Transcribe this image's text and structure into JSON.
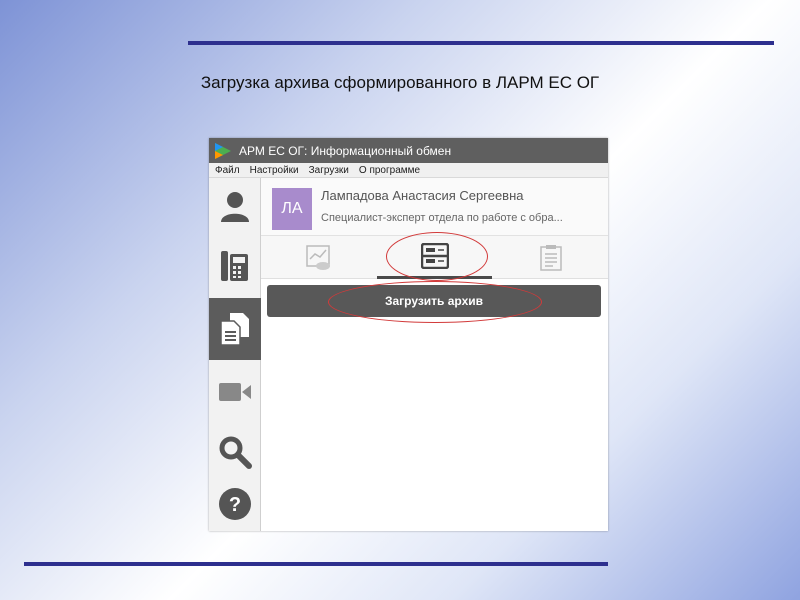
{
  "slide": {
    "title": "Загрузка архива сформированного в ЛАРМ ЕС ОГ"
  },
  "app": {
    "window_title": "АРМ ЕС ОГ: Информационный обмен",
    "menu": [
      "Файл",
      "Настройки",
      "Загрузки",
      "О программе"
    ],
    "user": {
      "initials": "ЛА",
      "name": "Лампадова Анастасия Сергеевна",
      "role": "Специалист-эксперт отдела по работе с обра..."
    },
    "sidebar_icons": [
      "user-icon",
      "phone-icon",
      "documents-icon",
      "video-icon",
      "search-icon",
      "help-icon"
    ],
    "active_sidebar": "documents-icon",
    "tabs": [
      {
        "icon": "cloud-chart-icon",
        "active": false
      },
      {
        "icon": "archive-icon",
        "active": true
      },
      {
        "icon": "document-list-icon",
        "active": false
      }
    ],
    "upload_button_label": "Загрузить архив",
    "colors": {
      "titlebar": "#5f5f5f",
      "active_sidebar": "#5c5c5c",
      "avatar": "#a88bcc",
      "button": "#585858",
      "highlight": "#d23a3a",
      "rule": "#2d2f8e"
    }
  }
}
